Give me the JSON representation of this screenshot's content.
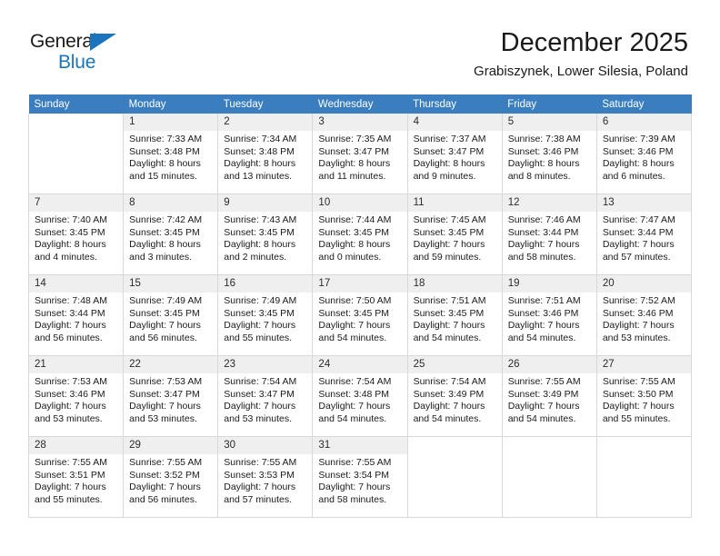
{
  "brand": {
    "name_part1": "General",
    "name_part2": "Blue",
    "triangle_icon": "triangle-icon",
    "color_primary": "#1b75bc",
    "color_text": "#1a1a1a"
  },
  "header": {
    "title": "December 2025",
    "subtitle": "Grabiszynek, Lower Silesia, Poland"
  },
  "theme": {
    "header_bar": "#3a7ebf",
    "daynum_bg": "#efefef",
    "cell_border": "#d8d8d8"
  },
  "calendar": {
    "weekdays": [
      "Sunday",
      "Monday",
      "Tuesday",
      "Wednesday",
      "Thursday",
      "Friday",
      "Saturday"
    ],
    "weeks": [
      [
        {
          "day": "",
          "blank": true,
          "lines": []
        },
        {
          "day": "1",
          "lines": [
            "Sunrise: 7:33 AM",
            "Sunset: 3:48 PM",
            "Daylight: 8 hours",
            "and 15 minutes."
          ]
        },
        {
          "day": "2",
          "lines": [
            "Sunrise: 7:34 AM",
            "Sunset: 3:48 PM",
            "Daylight: 8 hours",
            "and 13 minutes."
          ]
        },
        {
          "day": "3",
          "lines": [
            "Sunrise: 7:35 AM",
            "Sunset: 3:47 PM",
            "Daylight: 8 hours",
            "and 11 minutes."
          ]
        },
        {
          "day": "4",
          "lines": [
            "Sunrise: 7:37 AM",
            "Sunset: 3:47 PM",
            "Daylight: 8 hours",
            "and 9 minutes."
          ]
        },
        {
          "day": "5",
          "lines": [
            "Sunrise: 7:38 AM",
            "Sunset: 3:46 PM",
            "Daylight: 8 hours",
            "and 8 minutes."
          ]
        },
        {
          "day": "6",
          "lines": [
            "Sunrise: 7:39 AM",
            "Sunset: 3:46 PM",
            "Daylight: 8 hours",
            "and 6 minutes."
          ]
        }
      ],
      [
        {
          "day": "7",
          "lines": [
            "Sunrise: 7:40 AM",
            "Sunset: 3:45 PM",
            "Daylight: 8 hours",
            "and 4 minutes."
          ]
        },
        {
          "day": "8",
          "lines": [
            "Sunrise: 7:42 AM",
            "Sunset: 3:45 PM",
            "Daylight: 8 hours",
            "and 3 minutes."
          ]
        },
        {
          "day": "9",
          "lines": [
            "Sunrise: 7:43 AM",
            "Sunset: 3:45 PM",
            "Daylight: 8 hours",
            "and 2 minutes."
          ]
        },
        {
          "day": "10",
          "lines": [
            "Sunrise: 7:44 AM",
            "Sunset: 3:45 PM",
            "Daylight: 8 hours",
            "and 0 minutes."
          ]
        },
        {
          "day": "11",
          "lines": [
            "Sunrise: 7:45 AM",
            "Sunset: 3:45 PM",
            "Daylight: 7 hours",
            "and 59 minutes."
          ]
        },
        {
          "day": "12",
          "lines": [
            "Sunrise: 7:46 AM",
            "Sunset: 3:44 PM",
            "Daylight: 7 hours",
            "and 58 minutes."
          ]
        },
        {
          "day": "13",
          "lines": [
            "Sunrise: 7:47 AM",
            "Sunset: 3:44 PM",
            "Daylight: 7 hours",
            "and 57 minutes."
          ]
        }
      ],
      [
        {
          "day": "14",
          "lines": [
            "Sunrise: 7:48 AM",
            "Sunset: 3:44 PM",
            "Daylight: 7 hours",
            "and 56 minutes."
          ]
        },
        {
          "day": "15",
          "lines": [
            "Sunrise: 7:49 AM",
            "Sunset: 3:45 PM",
            "Daylight: 7 hours",
            "and 56 minutes."
          ]
        },
        {
          "day": "16",
          "lines": [
            "Sunrise: 7:49 AM",
            "Sunset: 3:45 PM",
            "Daylight: 7 hours",
            "and 55 minutes."
          ]
        },
        {
          "day": "17",
          "lines": [
            "Sunrise: 7:50 AM",
            "Sunset: 3:45 PM",
            "Daylight: 7 hours",
            "and 54 minutes."
          ]
        },
        {
          "day": "18",
          "lines": [
            "Sunrise: 7:51 AM",
            "Sunset: 3:45 PM",
            "Daylight: 7 hours",
            "and 54 minutes."
          ]
        },
        {
          "day": "19",
          "lines": [
            "Sunrise: 7:51 AM",
            "Sunset: 3:46 PM",
            "Daylight: 7 hours",
            "and 54 minutes."
          ]
        },
        {
          "day": "20",
          "lines": [
            "Sunrise: 7:52 AM",
            "Sunset: 3:46 PM",
            "Daylight: 7 hours",
            "and 53 minutes."
          ]
        }
      ],
      [
        {
          "day": "21",
          "lines": [
            "Sunrise: 7:53 AM",
            "Sunset: 3:46 PM",
            "Daylight: 7 hours",
            "and 53 minutes."
          ]
        },
        {
          "day": "22",
          "lines": [
            "Sunrise: 7:53 AM",
            "Sunset: 3:47 PM",
            "Daylight: 7 hours",
            "and 53 minutes."
          ]
        },
        {
          "day": "23",
          "lines": [
            "Sunrise: 7:54 AM",
            "Sunset: 3:47 PM",
            "Daylight: 7 hours",
            "and 53 minutes."
          ]
        },
        {
          "day": "24",
          "lines": [
            "Sunrise: 7:54 AM",
            "Sunset: 3:48 PM",
            "Daylight: 7 hours",
            "and 54 minutes."
          ]
        },
        {
          "day": "25",
          "lines": [
            "Sunrise: 7:54 AM",
            "Sunset: 3:49 PM",
            "Daylight: 7 hours",
            "and 54 minutes."
          ]
        },
        {
          "day": "26",
          "lines": [
            "Sunrise: 7:55 AM",
            "Sunset: 3:49 PM",
            "Daylight: 7 hours",
            "and 54 minutes."
          ]
        },
        {
          "day": "27",
          "lines": [
            "Sunrise: 7:55 AM",
            "Sunset: 3:50 PM",
            "Daylight: 7 hours",
            "and 55 minutes."
          ]
        }
      ],
      [
        {
          "day": "28",
          "lines": [
            "Sunrise: 7:55 AM",
            "Sunset: 3:51 PM",
            "Daylight: 7 hours",
            "and 55 minutes."
          ]
        },
        {
          "day": "29",
          "lines": [
            "Sunrise: 7:55 AM",
            "Sunset: 3:52 PM",
            "Daylight: 7 hours",
            "and 56 minutes."
          ]
        },
        {
          "day": "30",
          "lines": [
            "Sunrise: 7:55 AM",
            "Sunset: 3:53 PM",
            "Daylight: 7 hours",
            "and 57 minutes."
          ]
        },
        {
          "day": "31",
          "lines": [
            "Sunrise: 7:55 AM",
            "Sunset: 3:54 PM",
            "Daylight: 7 hours",
            "and 58 minutes."
          ]
        },
        {
          "day": "",
          "blank": true,
          "lines": []
        },
        {
          "day": "",
          "blank": true,
          "lines": []
        },
        {
          "day": "",
          "blank": true,
          "lines": []
        }
      ]
    ]
  }
}
